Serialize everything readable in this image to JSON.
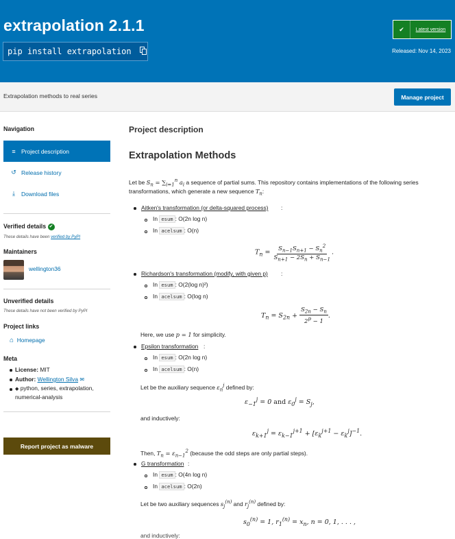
{
  "header": {
    "title": "extrapolation 2.1.1",
    "pip_command": "pip install extrapolation",
    "latest_label": "Latest version",
    "released": "Released: Nov 14, 2023",
    "summary": "Extrapolation methods to real series",
    "manage_label": "Manage project"
  },
  "sidebar": {
    "nav_heading": "Navigation",
    "nav": [
      "Project description",
      "Release history",
      "Download files"
    ],
    "verified_heading": "Verified details",
    "verified_note_prefix": "These details have been ",
    "verified_note_link": "verified by PyPI",
    "maintainers_heading": "Maintainers",
    "maintainer": "wellington36",
    "unverified_heading": "Unverified details",
    "unverified_note": "These details have not been verified by PyPI",
    "project_links_heading": "Project links",
    "homepage": "Homepage",
    "meta_heading": "Meta",
    "license_label": "License:",
    "license_value": "MIT",
    "author_label": "Author:",
    "author_value": "Wellington Silva",
    "tags_line1": "python, series, extrapolation,",
    "tags_line2": "numerical-analysis",
    "report_label": "Report project as malware"
  },
  "content": {
    "section_title": "Project description",
    "heading": "Extrapolation Methods",
    "intro_1": "Let be",
    "intro_2": "a sequence of partial sums. This repository contains implementations of the following series",
    "intro_3": "transformations, which generate a new sequence",
    "methods": [
      {
        "name": "Aitken's transformation (or delta-squared process)",
        "esum": "O(2n log n)",
        "acelsum": "O(n)"
      },
      {
        "name": "Richardson's transformation (modify, with given p)",
        "esum": "O(2(log n)²)",
        "acelsum": "O(log n)"
      },
      {
        "name": "Epsilon transformation",
        "esum": "O(2n log n)",
        "acelsum": "O(n)"
      },
      {
        "name": "G transformation",
        "esum": "O(4n log n)",
        "acelsum": "O(2n)"
      }
    ],
    "in_label": "In",
    "esum": "esum",
    "acelsum": "acelsum",
    "here_p": "Here, we use",
    "here_p2": "for simplicity.",
    "epsilon_aux": "Let be the auxiliary sequence",
    "defined_by": "defined by:",
    "inductively": "and inductively:",
    "then_1": "Then,",
    "then_2": "(because the odd steps are only partial steps).",
    "g_aux_1": "Let be two auxiliary sequences",
    "g_aux_2": "and",
    "g_aux_3": "defined by:",
    "cut_text": "and inductively:"
  }
}
